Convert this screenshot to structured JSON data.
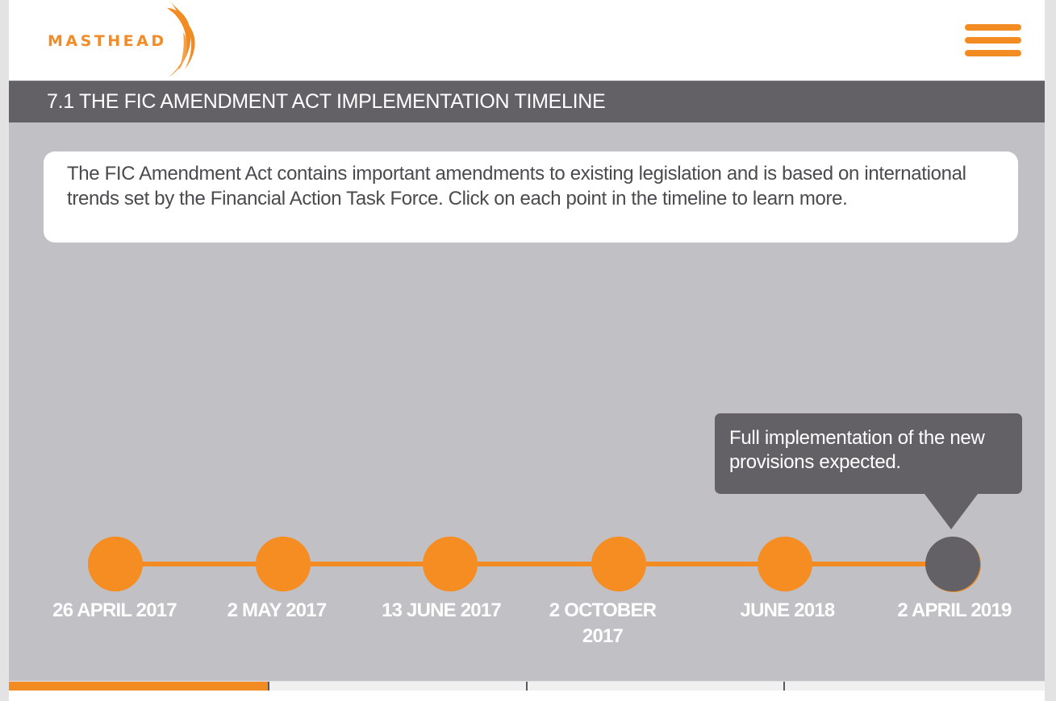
{
  "header": {
    "logo_text": "MASTHEAD",
    "menu_icon": "hamburger-menu-icon"
  },
  "page": {
    "title": "7.1 THE FIC AMENDMENT ACT IMPLEMENTATION TIMELINE",
    "intro": "The FIC Amendment Act contains important amendments to existing legislation and is based on international trends set by the Financial Action Task Force. Click on each point in the timeline to learn more."
  },
  "timeline": {
    "points": [
      {
        "date": "26 APRIL 2017",
        "active": false
      },
      {
        "date": "2 MAY 2017",
        "active": false
      },
      {
        "date": "13 JUNE 2017",
        "active": false
      },
      {
        "date": "2 OCTOBER 2017",
        "active": false
      },
      {
        "date": "JUNE 2018",
        "active": false
      },
      {
        "date": "2 APRIL 2019",
        "active": true
      }
    ],
    "tooltip": "Full implementation of the new provisions expected."
  },
  "progress": {
    "segments": 4,
    "completed_fraction": 0.25
  },
  "colors": {
    "accent": "#f28c22",
    "dark": "#636166",
    "background": "#c1c0c5"
  }
}
